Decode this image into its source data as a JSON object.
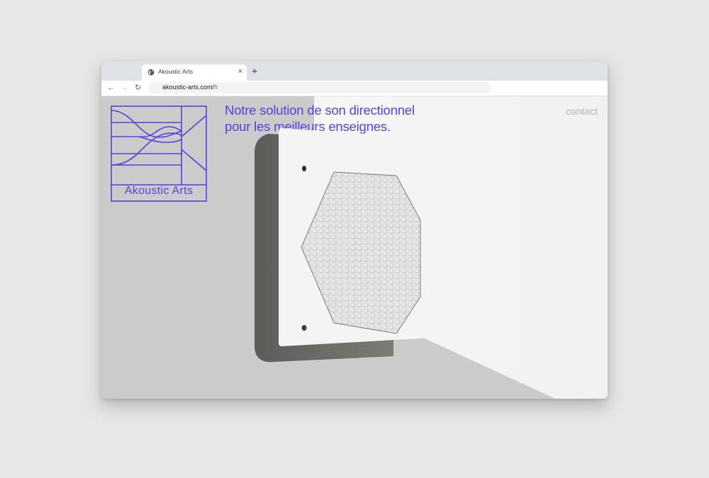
{
  "browser": {
    "tab": {
      "title": "Akoustic Arts",
      "close_glyph": "×",
      "favicon": "globe-icon"
    },
    "new_tab_glyph": "+",
    "nav": {
      "back_glyph": "←",
      "forward_glyph": "→",
      "reload_glyph": "↻"
    },
    "address": {
      "domain": "akoustic-arts.com/",
      "path": "fr"
    }
  },
  "page": {
    "logo_text": "Akoustic Arts",
    "headline_line1": "Notre solution de son directionnel",
    "headline_line2": "pour les meilleurs enseignes.",
    "contact_label": "contact",
    "accent_color": "#5b3fd8",
    "background_color": "#cbcbcb",
    "product_image": "directional-speaker-panel"
  }
}
